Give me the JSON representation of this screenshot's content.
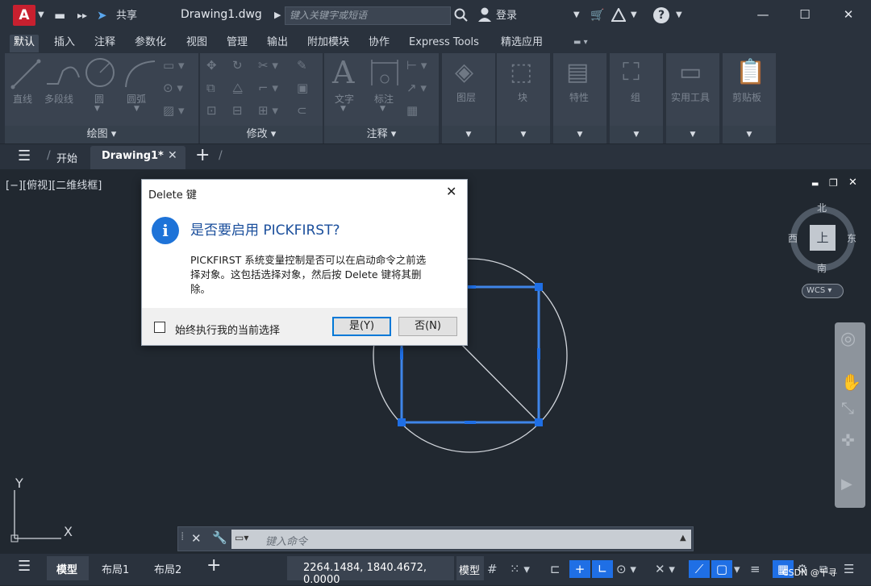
{
  "titlebar": {
    "logo": "A",
    "share": "共享",
    "title": "Drawing1.dwg",
    "search_placeholder": "键入关键字或短语",
    "login": "登录",
    "help": "?"
  },
  "ribbon_tabs": [
    "默认",
    "插入",
    "注释",
    "参数化",
    "视图",
    "管理",
    "输出",
    "附加模块",
    "协作",
    "Express Tools",
    "精选应用"
  ],
  "ribbon": {
    "draw": {
      "title": "绘图 ▾",
      "line": "直线",
      "polyline": "多段线",
      "circle": "圆",
      "arc": "圆弧"
    },
    "modify": {
      "title": "修改 ▾"
    },
    "annotation": {
      "title": "注释 ▾",
      "text": "文字",
      "dimension": "标注"
    },
    "layers": "图层",
    "block": "块",
    "properties": "特性",
    "groups": "组",
    "utilities": "实用工具",
    "clipboard": "剪贴板"
  },
  "doc_tabs": {
    "start": "开始",
    "drawing": "Drawing1*"
  },
  "viewport": {
    "label": "[−][俯视][二维线框]",
    "compass": {
      "north": "北",
      "south": "南",
      "east": "东",
      "west": "西",
      "center": "上"
    },
    "wcs": "WCS",
    "ucs_y": "Y",
    "ucs_x": "X"
  },
  "command": {
    "placeholder": "键入命令"
  },
  "dialog": {
    "title": "Delete 键",
    "heading": "是否要启用 PICKFIRST?",
    "body_line1": "PICKFIRST 系统变量控制是否可以在启动命令之前选",
    "body_line2": "择对象。这包括选择对象，然后按 Delete 键将其删",
    "body_line3": "除。",
    "checkbox_label": "始终执行我的当前选择",
    "yes": "是(Y)",
    "no": "否(N)"
  },
  "statusbar": {
    "model_tab": "模型",
    "layout1": "布局1",
    "layout2": "布局2",
    "coords": "2264.1484, 1840.4672, 0.0000",
    "model_btn": "模型",
    "watermark": "CSDN @千寻"
  },
  "colors": {
    "accent": "#1e73d8",
    "selection": "#3f85e8",
    "grip": "#1f6fe5"
  }
}
